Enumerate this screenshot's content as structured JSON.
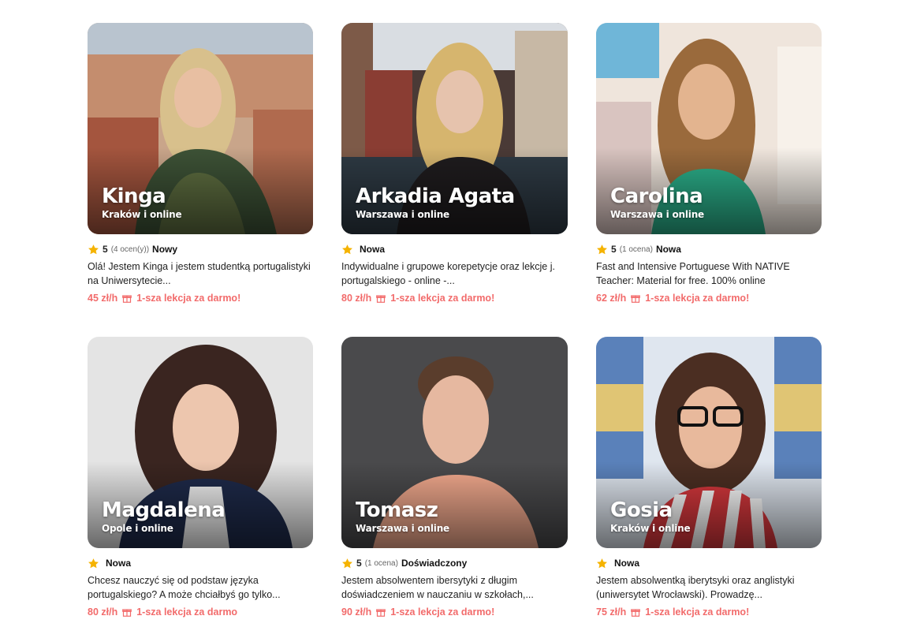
{
  "colors": {
    "accent": "#f26b6b",
    "star": "#f5b301"
  },
  "tutors": [
    {
      "name": "Kinga",
      "location": "Kraków i online",
      "rating": "5",
      "reviews": "(4 ocen(y))",
      "badge": "Nowy",
      "description": "Olá! Jestem Kinga i jestem studentką portugalistyki na Uniwersytecie...",
      "price": "45 zł/h",
      "promo": "1-sza lekcja za darmo!"
    },
    {
      "name": "Arkadia Agata",
      "location": "Warszawa i online",
      "rating": "",
      "reviews": "",
      "badge": "Nowa",
      "description": "Indywidualne i grupowe korepetycje oraz lekcje j. portugalskiego - online -...",
      "price": "80 zł/h",
      "promo": "1-sza lekcja za darmo!"
    },
    {
      "name": "Carolina",
      "location": "Warszawa i online",
      "rating": "5",
      "reviews": "(1 ocena)",
      "badge": "Nowa",
      "description": "Fast and Intensive Portuguese With NATIVE Teacher: Material for free. 100% online",
      "price": "62 zł/h",
      "promo": "1-sza lekcja za darmo!"
    },
    {
      "name": "Magdalena",
      "location": "Opole i online",
      "rating": "",
      "reviews": "",
      "badge": "Nowa",
      "description": "Chcesz nauczyć się od podstaw języka portugalskiego? A może chciałbyś go tylko...",
      "price": "80 zł/h",
      "promo": "1-sza lekcja za darmo"
    },
    {
      "name": "Tomasz",
      "location": "Warszawa i online",
      "rating": "5",
      "reviews": "(1 ocena)",
      "badge": "Doświadczony",
      "description": "Jestem absolwentem ibersytyki z długim doświadczeniem w nauczaniu w szkołach,...",
      "price": "90 zł/h",
      "promo": "1-sza lekcja za darmo!"
    },
    {
      "name": "Gosia",
      "location": "Kraków i online",
      "rating": "",
      "reviews": "",
      "badge": "Nowa",
      "description": "Jestem absolwentką iberytsyki oraz anglistyki (uniwersytet Wrocławski). Prowadzę...",
      "price": "75 zł/h",
      "promo": "1-sza lekcja za darmo!"
    }
  ]
}
